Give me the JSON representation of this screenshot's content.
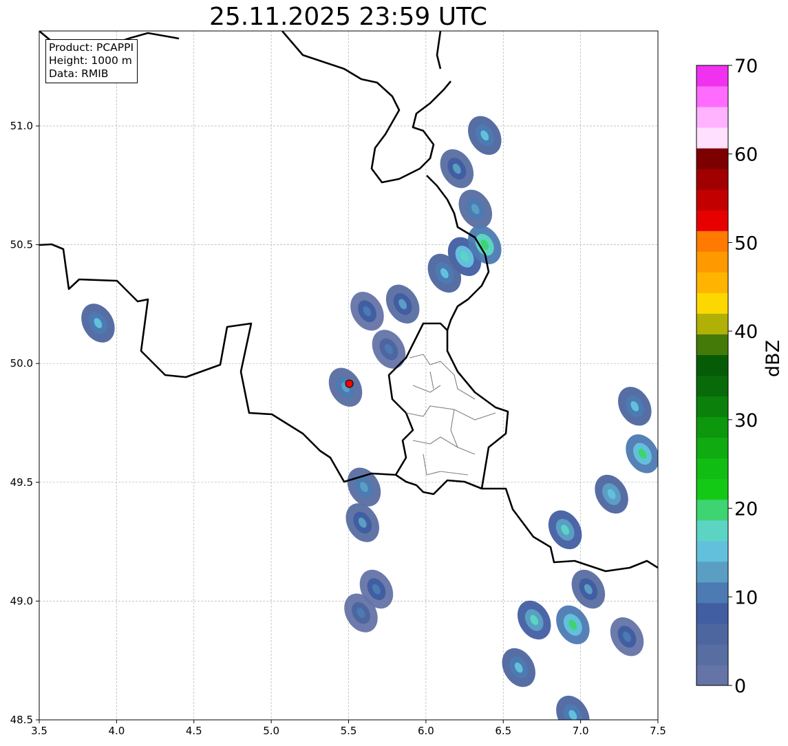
{
  "title": "25.11.2025 23:59 UTC",
  "info": {
    "product": "Product: PCAPPI",
    "height": "Height: 1000 m",
    "data": "Data: RMIB"
  },
  "map": {
    "x_range": [
      3.5,
      7.5
    ],
    "y_range": [
      48.5,
      51.4
    ],
    "x_ticks": [
      3.5,
      4.0,
      4.5,
      5.0,
      5.5,
      6.0,
      6.5,
      7.0,
      7.5
    ],
    "y_ticks": [
      48.5,
      49.0,
      49.5,
      50.0,
      50.5,
      51.0
    ],
    "grid": true,
    "radar_site": {
      "lon": 5.505,
      "lat": 49.915,
      "color": "#ff0000"
    },
    "echoes": [
      {
        "lon": 3.88,
        "lat": 50.17,
        "dbz": 15
      },
      {
        "lon": 5.48,
        "lat": 49.9,
        "dbz": 14
      },
      {
        "lon": 5.62,
        "lat": 50.22,
        "dbz": 12
      },
      {
        "lon": 5.76,
        "lat": 50.06,
        "dbz": 11
      },
      {
        "lon": 5.85,
        "lat": 50.25,
        "dbz": 13
      },
      {
        "lon": 5.6,
        "lat": 49.48,
        "dbz": 14
      },
      {
        "lon": 5.59,
        "lat": 49.33,
        "dbz": 13
      },
      {
        "lon": 5.68,
        "lat": 49.05,
        "dbz": 12
      },
      {
        "lon": 5.58,
        "lat": 48.95,
        "dbz": 11
      },
      {
        "lon": 6.2,
        "lat": 50.82,
        "dbz": 13
      },
      {
        "lon": 6.38,
        "lat": 50.96,
        "dbz": 15
      },
      {
        "lon": 6.32,
        "lat": 50.65,
        "dbz": 14
      },
      {
        "lon": 6.25,
        "lat": 50.45,
        "dbz": 19
      },
      {
        "lon": 6.38,
        "lat": 50.5,
        "dbz": 22
      },
      {
        "lon": 6.12,
        "lat": 50.38,
        "dbz": 16
      },
      {
        "lon": 6.9,
        "lat": 49.3,
        "dbz": 18
      },
      {
        "lon": 7.2,
        "lat": 49.45,
        "dbz": 17
      },
      {
        "lon": 7.4,
        "lat": 49.62,
        "dbz": 21
      },
      {
        "lon": 7.35,
        "lat": 49.82,
        "dbz": 16
      },
      {
        "lon": 7.05,
        "lat": 49.05,
        "dbz": 13
      },
      {
        "lon": 6.7,
        "lat": 48.92,
        "dbz": 18
      },
      {
        "lon": 6.6,
        "lat": 48.72,
        "dbz": 15
      },
      {
        "lon": 6.95,
        "lat": 48.9,
        "dbz": 20
      },
      {
        "lon": 7.3,
        "lat": 48.85,
        "dbz": 12
      },
      {
        "lon": 6.95,
        "lat": 48.52,
        "dbz": 16
      }
    ]
  },
  "colorbar": {
    "label": "dBZ",
    "range": [
      0,
      70
    ],
    "step": 2.5,
    "tick_labels": [
      "0",
      "10",
      "20",
      "30",
      "40",
      "50",
      "60",
      "70"
    ],
    "colors": [
      "#6474a6",
      "#586da1",
      "#4e66a0",
      "#425ea2",
      "#4c7ab2",
      "#5a9ec4",
      "#63c0dc",
      "#5bd4c4",
      "#3dd471",
      "#13c916",
      "#11bd12",
      "#0fab10",
      "#0d970d",
      "#0b800b",
      "#086a08",
      "#065c06",
      "#447a08",
      "#b0b006",
      "#fdd800",
      "#ffb400",
      "#ff9900",
      "#ff7a00",
      "#e60000",
      "#c20000",
      "#a00000",
      "#7d0000",
      "#ffe0ff",
      "#ffb2ff",
      "#ff6bff",
      "#f032f0"
    ]
  }
}
